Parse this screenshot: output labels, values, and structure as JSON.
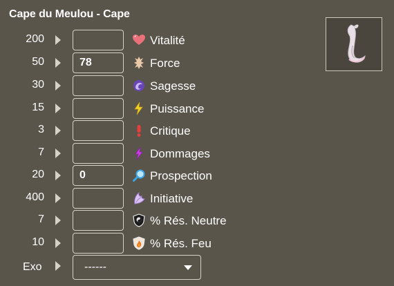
{
  "item": {
    "title": "Cape du Meulou - Cape",
    "image_icon": "cape-item-icon"
  },
  "stats": [
    {
      "value": "200",
      "input": "",
      "label": "Vitalité",
      "icon": "heart-icon",
      "color": "#e8717a"
    },
    {
      "value": "50",
      "input": "78",
      "label": "Force",
      "icon": "force-icon",
      "color": "#e9c9a8"
    },
    {
      "value": "30",
      "input": "",
      "label": "Sagesse",
      "icon": "sagesse-icon",
      "color": "#7a55c8"
    },
    {
      "value": "15",
      "input": "",
      "label": "Puissance",
      "icon": "lightning-icon",
      "color": "#f0d22a"
    },
    {
      "value": "3",
      "input": "",
      "label": "Critique",
      "icon": "exclamation-icon",
      "color": "#e63d3d"
    },
    {
      "value": "7",
      "input": "",
      "label": "Dommages",
      "icon": "damage-icon",
      "color": "#c83fe0"
    },
    {
      "value": "20",
      "input": "0",
      "label": "Prospection",
      "icon": "magnifier-icon",
      "color": "#3aa7e8"
    },
    {
      "value": "400",
      "input": "",
      "label": "Initiative",
      "icon": "initiative-icon",
      "color": "#b58be0"
    },
    {
      "value": "7",
      "input": "",
      "label": "% Rés. Neutre",
      "icon": "neutral-resist-icon",
      "color": "#222222"
    },
    {
      "value": "10",
      "input": "",
      "label": "% Rés. Feu",
      "icon": "fire-resist-icon",
      "color": "#f07a22"
    }
  ],
  "exo": {
    "label": "Exo",
    "selected": "------"
  }
}
